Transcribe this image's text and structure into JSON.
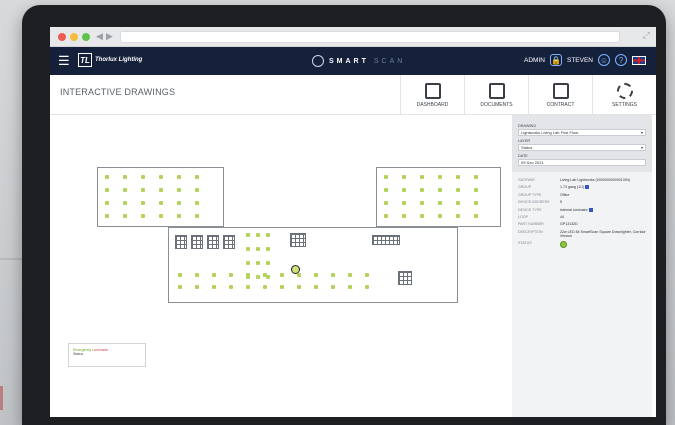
{
  "app": {
    "logo_text": "Thorlux Lighting",
    "brand_main": "SMART",
    "brand_sub": "SCAN",
    "page_title": "INTERACTIVE DRAWINGS",
    "user_admin": "ADMIN",
    "user_name": "STEVEN"
  },
  "tabs": [
    {
      "label": "DASHBOARD",
      "icon": "dashboard-icon"
    },
    {
      "label": "DOCUMENTS",
      "icon": "documents-icon"
    },
    {
      "label": "CONTRACT",
      "icon": "contract-icon"
    },
    {
      "label": "SETTINGS",
      "icon": "settings-icon"
    }
  ],
  "form": {
    "drawing_label": "DRAWING",
    "drawing_value": "Lightworks Living Lab First Floor",
    "layer_label": "LAYER",
    "layer_value": "Status",
    "date_label": "DATE",
    "date_value": "09 Dec 2021"
  },
  "properties": [
    {
      "key": "GATEWAY",
      "value": "Living Lab Lightworks (0000000000001394)"
    },
    {
      "key": "GROUP",
      "value": "1.73 gang (1/1)"
    },
    {
      "key": "GROUP TYPE",
      "value": "Office"
    },
    {
      "key": "DEVICE ADDRESS",
      "value": "5"
    },
    {
      "key": "DEVICE TYPE",
      "value": "Internal luminaire"
    },
    {
      "key": "LOOP",
      "value": "44"
    },
    {
      "key": "PART NUMBER",
      "value": "GP13132D"
    },
    {
      "key": "DESCRIPTION",
      "value": "22w LED 84 SmartScan Square Downlighter, Corridor Version"
    },
    {
      "key": "STATUS",
      "value": ""
    }
  ],
  "legend": {
    "ok": "Emergency",
    "fault": "Luminaire",
    "text": "Status"
  },
  "colors": {
    "header": "#15203b",
    "fixture_ok": "#b4d35a",
    "fault": "#d23b3b"
  }
}
